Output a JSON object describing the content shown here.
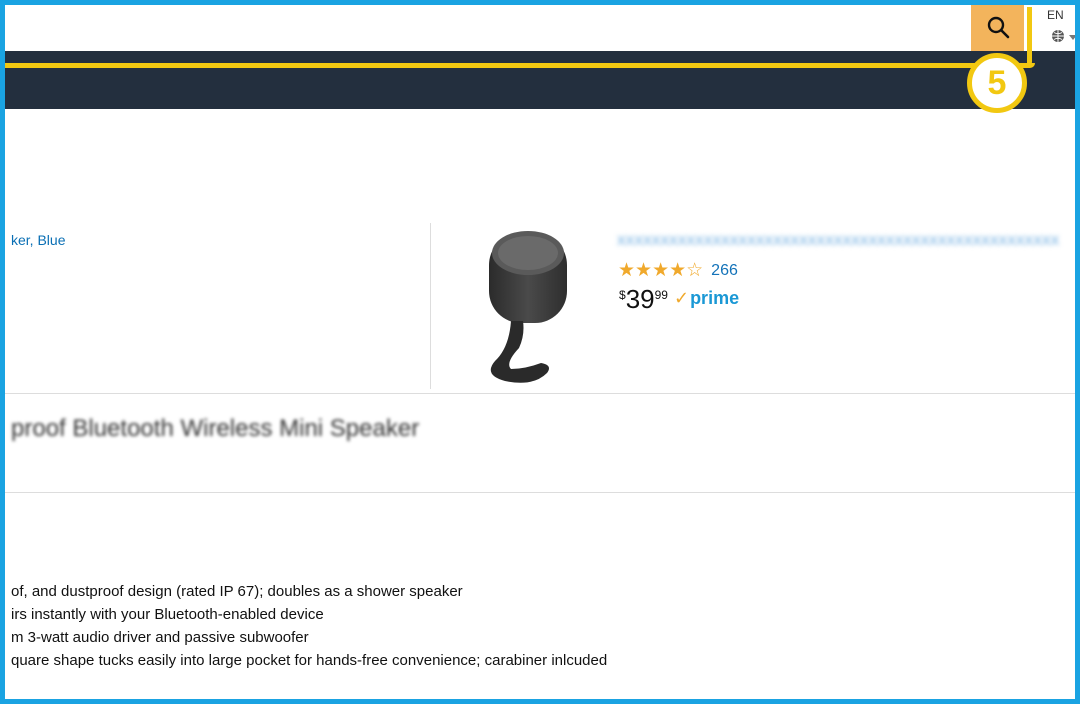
{
  "header": {
    "search_value": "",
    "search_placeholder": "",
    "search_icon": "search-icon",
    "language_code": "EN",
    "language_icon": "globe-icon"
  },
  "annotation": {
    "step_number": "5",
    "highlight_color": "#f2c811",
    "frame_color": "#1aa3e2"
  },
  "results": {
    "left_item_title_fragment": "ker, Blue",
    "item": {
      "title": "XXXXXXXXXXXXXXXXXXXXXXXXXXXXXXXXXXXXXXXXXXXXXXXXXXX",
      "rating_value": 4,
      "rating_max": 5,
      "stars_text": "★★★★☆",
      "review_count": "266",
      "price_symbol": "$",
      "price_whole": "39",
      "price_fraction": "99",
      "prime_check": "✓",
      "prime_label": "prime"
    }
  },
  "detail": {
    "title_fragment": "proof Bluetooth Wireless Mini Speaker",
    "features": [
      "of, and dustproof design (rated IP 67); doubles as a shower speaker",
      "irs instantly with your Bluetooth-enabled device",
      "m 3-watt audio driver and passive subwoofer",
      "quare shape tucks easily into large pocket for hands-free convenience; carabiner inlcuded"
    ]
  },
  "colors": {
    "nav_dark": "#232f3e",
    "search_button": "#f3b45c",
    "link_blue": "#0a6fb4",
    "star_orange": "#f0a92c",
    "prime_blue": "#1a98d5"
  }
}
